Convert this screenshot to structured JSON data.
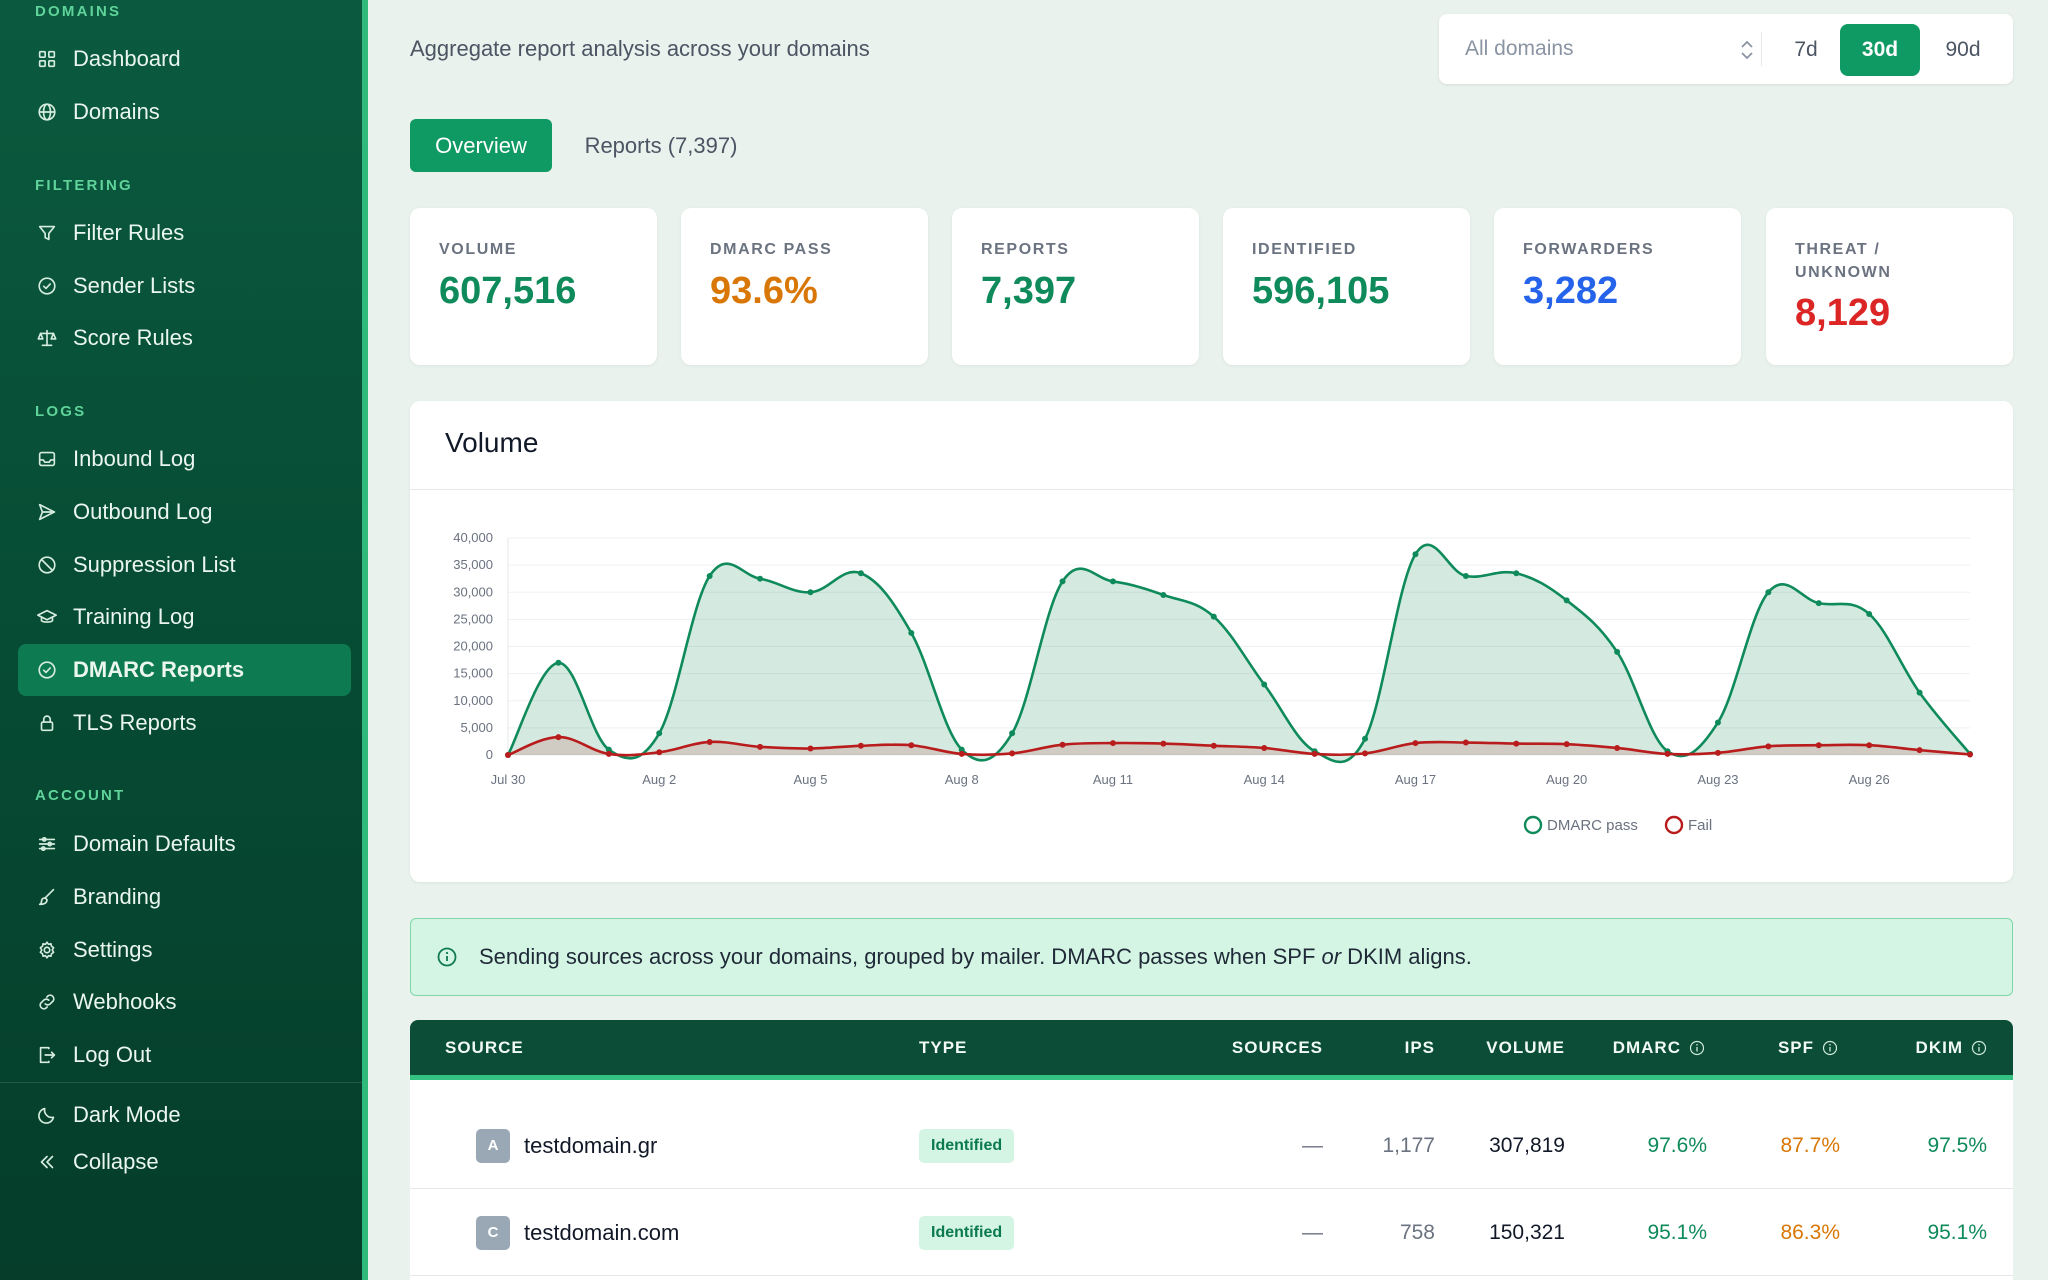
{
  "sidebar": {
    "sections": [
      {
        "title": "DOMAINS",
        "items": [
          {
            "label": "Dashboard",
            "icon": "dashboard-icon"
          },
          {
            "label": "Domains",
            "icon": "globe-icon"
          }
        ]
      },
      {
        "title": "FILTERING",
        "items": [
          {
            "label": "Filter Rules",
            "icon": "filter-icon"
          },
          {
            "label": "Sender Lists",
            "icon": "check-circle-icon"
          },
          {
            "label": "Score Rules",
            "icon": "scale-icon"
          }
        ]
      },
      {
        "title": "LOGS",
        "items": [
          {
            "label": "Inbound Log",
            "icon": "inbox-icon"
          },
          {
            "label": "Outbound Log",
            "icon": "send-icon"
          },
          {
            "label": "Suppression List",
            "icon": "ban-icon"
          },
          {
            "label": "Training Log",
            "icon": "graduation-cap-icon"
          },
          {
            "label": "DMARC Reports",
            "icon": "check-circle-icon",
            "active": true
          },
          {
            "label": "TLS Reports",
            "icon": "lock-icon"
          }
        ]
      },
      {
        "title": "ACCOUNT",
        "items": [
          {
            "label": "Domain Defaults",
            "icon": "sliders-icon"
          },
          {
            "label": "Branding",
            "icon": "brush-icon"
          },
          {
            "label": "Settings",
            "icon": "gear-icon"
          },
          {
            "label": "Webhooks",
            "icon": "link-icon"
          },
          {
            "label": "Log Out",
            "icon": "logout-icon"
          }
        ]
      }
    ],
    "footer": {
      "dark_mode": "Dark Mode",
      "collapse": "Collapse"
    }
  },
  "header": {
    "subtitle": "Aggregate report analysis across your domains",
    "domain_select": "All domains",
    "ranges": [
      "7d",
      "30d",
      "90d"
    ],
    "active_range": "30d"
  },
  "tabs": {
    "overview": "Overview",
    "reports": "Reports (7,397)"
  },
  "stats": [
    {
      "label": "VOLUME",
      "value": "607,516",
      "color": "#0f8a5a"
    },
    {
      "label": "DMARC PASS",
      "value": "93.6%",
      "color": "#d97706"
    },
    {
      "label": "REPORTS",
      "value": "7,397",
      "color": "#0f8a5a"
    },
    {
      "label": "IDENTIFIED",
      "value": "596,105",
      "color": "#0f8a5a"
    },
    {
      "label": "FORWARDERS",
      "value": "3,282",
      "color": "#2563eb"
    },
    {
      "label": "THREAT / UNKNOWN",
      "value": "8,129",
      "color": "#dc2626"
    }
  ],
  "volume": {
    "title": "Volume"
  },
  "chart_data": {
    "type": "area",
    "title": "Volume",
    "x": [
      "Jul 30",
      "Jul 31",
      "Aug 1",
      "Aug 2",
      "Aug 3",
      "Aug 4",
      "Aug 5",
      "Aug 6",
      "Aug 7",
      "Aug 8",
      "Aug 9",
      "Aug 10",
      "Aug 11",
      "Aug 12",
      "Aug 13",
      "Aug 14",
      "Aug 15",
      "Aug 16",
      "Aug 17",
      "Aug 18",
      "Aug 19",
      "Aug 20",
      "Aug 21",
      "Aug 22",
      "Aug 23",
      "Aug 24",
      "Aug 25",
      "Aug 26",
      "Aug 27",
      "Aug 28"
    ],
    "x_tick_labels": [
      "Jul 30",
      "Aug 2",
      "Aug 5",
      "Aug 8",
      "Aug 11",
      "Aug 14",
      "Aug 17",
      "Aug 20",
      "Aug 23",
      "Aug 26"
    ],
    "y_ticks": [
      "0",
      "5,000",
      "10,000",
      "15,000",
      "20,000",
      "25,000",
      "30,000",
      "35,000",
      "40,000"
    ],
    "ylim": [
      0,
      40000
    ],
    "series": [
      {
        "name": "DMARC pass",
        "color": "#0f8a5a",
        "values": [
          0,
          17000,
          1000,
          4000,
          33000,
          32500,
          30000,
          33500,
          22500,
          1000,
          4000,
          32000,
          32000,
          29500,
          25500,
          13000,
          700,
          3000,
          37000,
          33000,
          33500,
          28500,
          19000,
          700,
          6000,
          30000,
          28000,
          26000,
          11500,
          200
        ]
      },
      {
        "name": "Fail",
        "color": "#b91c1c",
        "values": [
          0,
          3300,
          200,
          500,
          2400,
          1500,
          1200,
          1700,
          1800,
          200,
          300,
          1900,
          2200,
          2100,
          1700,
          1300,
          200,
          300,
          2200,
          2300,
          2100,
          2000,
          1300,
          200,
          400,
          1600,
          1800,
          1800,
          900,
          100
        ]
      }
    ],
    "legend": "bottom-center",
    "grid": true
  },
  "info": {
    "prefix": "Sending sources across your domains, grouped by mailer. DMARC passes when SPF ",
    "emphasis": "or",
    "suffix": " DKIM aligns."
  },
  "table": {
    "columns": [
      "SOURCE",
      "TYPE",
      "SOURCES",
      "IPS",
      "VOLUME",
      "DMARC",
      "SPF",
      "DKIM"
    ],
    "rows": [
      {
        "avatar": "A",
        "source": "testdomain.gr",
        "type": "Identified",
        "sources": "—",
        "ips": "1,177",
        "volume": "307,819",
        "dmarc": "97.6%",
        "spf": "87.7%",
        "dkim": "97.5%"
      },
      {
        "avatar": "C",
        "source": "testdomain.com",
        "type": "Identified",
        "sources": "—",
        "ips": "758",
        "volume": "150,321",
        "dmarc": "95.1%",
        "spf": "86.3%",
        "dkim": "95.1%"
      }
    ],
    "colors": {
      "dmarc": "#0f8a5a",
      "spf": "#d97706",
      "dkim": "#0f8a5a"
    }
  }
}
